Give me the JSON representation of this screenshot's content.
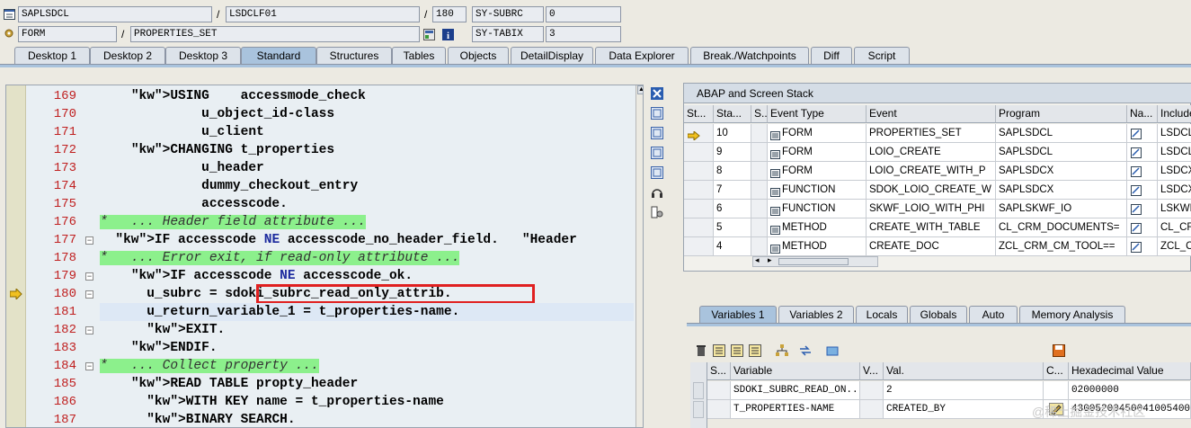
{
  "header": {
    "program": "SAPLSDCL",
    "include": "LSDCLF01",
    "line": "180",
    "subrc_label": "SY-SUBRC",
    "subrc_value": "0",
    "event_type": "FORM",
    "event": "PROPERTIES_SET",
    "tabix_label": "SY-TABIX",
    "tabix_value": "3",
    "slash": "/"
  },
  "tabs": [
    "Desktop 1",
    "Desktop 2",
    "Desktop 3",
    "Standard",
    "Structures",
    "Tables",
    "Objects",
    "DetailDisplay",
    "Data Explorer",
    "Break./Watchpoints",
    "Diff",
    "Script"
  ],
  "active_tab": "Standard",
  "editor": {
    "lines": [
      {
        "n": "169",
        "t": "    <k>USING</k>    accessmode_check"
      },
      {
        "n": "170",
        "t": "             u_object_id-class"
      },
      {
        "n": "171",
        "t": "             u_client"
      },
      {
        "n": "172",
        "t": "    <k>CHANGING</k> t_properties"
      },
      {
        "n": "173",
        "t": "             u_header"
      },
      {
        "n": "174",
        "t": "             dummy_checkout_entry"
      },
      {
        "n": "175",
        "t": "             accesscode."
      },
      {
        "n": "176",
        "t": "*   ... Header field attribute ..."
      },
      {
        "n": "177",
        "t": "  <k>IF</k> accesscode <k>NE</k> accesscode_no_header_field.   \"Header"
      },
      {
        "n": "178",
        "t": "*   ... Error exit, if read-only attribute ..."
      },
      {
        "n": "179",
        "t": "    <k>IF</k> accesscode <k>NE</k> accesscode_ok."
      },
      {
        "n": "180",
        "t": "      u_subrc = sdoki_subrc_read_only_attrib."
      },
      {
        "n": "181",
        "t": "      u_return_variable_1 = t_properties-name."
      },
      {
        "n": "182",
        "t": "      <k>EXIT</k>."
      },
      {
        "n": "183",
        "t": "    <k>ENDIF</k>."
      },
      {
        "n": "184",
        "t": "*   ... Collect property ..."
      },
      {
        "n": "185",
        "t": "    <k>READ TABLE</k> propty_header"
      },
      {
        "n": "186",
        "t": "      <k>WITH KEY</k> name = t_properties-name"
      },
      {
        "n": "187",
        "t": "      <k>BINARY SEARCH</k>."
      }
    ]
  },
  "stack": {
    "title": "ABAP and Screen Stack",
    "columns": [
      "St...",
      "Sta...",
      "S...",
      "Event Type",
      "Event",
      "Program",
      "Na...",
      "Include"
    ],
    "rows": [
      {
        "sta": "10",
        "type": "FORM",
        "event": "PROPERTIES_SET",
        "program": "SAPLSDCL",
        "include": "LSDCLF",
        "current": true
      },
      {
        "sta": "9",
        "type": "FORM",
        "event": "LOIO_CREATE",
        "program": "SAPLSDCL",
        "include": "LSDCLU"
      },
      {
        "sta": "8",
        "type": "FORM",
        "event": "LOIO_CREATE_WITH_P",
        "program": "SAPLSDCX",
        "include": "LSDCXU"
      },
      {
        "sta": "7",
        "type": "FUNCTION",
        "event": "SDOK_LOIO_CREATE_W",
        "program": "SAPLSDCX",
        "include": "LSDCXU"
      },
      {
        "sta": "6",
        "type": "FUNCTION",
        "event": "SKWF_LOIO_WITH_PHI",
        "program": "SAPLSKWF_IO",
        "include": "LSKWF"
      },
      {
        "sta": "5",
        "type": "METHOD",
        "event": "CREATE_WITH_TABLE",
        "program": "CL_CRM_DOCUMENTS=",
        "include": "CL_CRM"
      },
      {
        "sta": "4",
        "type": "METHOD",
        "event": "CREATE_DOC",
        "program": "ZCL_CRM_CM_TOOL==",
        "include": "ZCL_CR"
      }
    ]
  },
  "var_tabs": [
    "Variables 1",
    "Variables 2",
    "Locals",
    "Globals",
    "Auto",
    "Memory Analysis"
  ],
  "active_var_tab": "Variables 1",
  "variables": {
    "columns": [
      "S...",
      "Variable",
      "V...",
      "Val.",
      "C...",
      "Hexadecimal Value"
    ],
    "rows": [
      {
        "variable": "SDOKI_SUBRC_READ_ON...",
        "value": "2",
        "hex": "02000000"
      },
      {
        "variable": "T_PROPERTIES-NAME",
        "value": "CREATED_BY",
        "hex": "43005200450041005400"
      }
    ]
  },
  "watermark": "@稀土掘金技术社区",
  "colors": {
    "tab_active": "#a9c3dd",
    "highlight_box": "#e02020",
    "comment_bg": "#8cf08c",
    "keyword": "#1c2a9e",
    "line_number": "#c02020"
  }
}
